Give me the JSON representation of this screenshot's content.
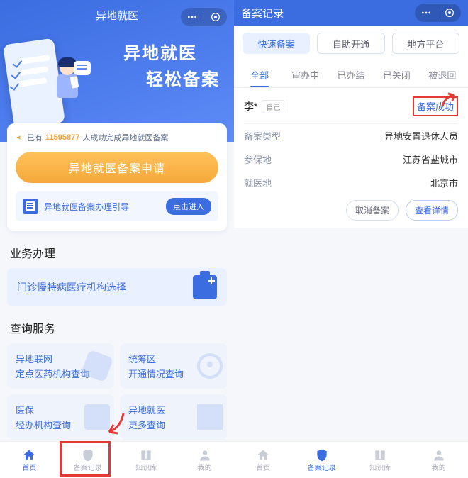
{
  "colors": {
    "primary": "#3b6de0",
    "accent": "#f5a83a",
    "danger": "#e53935"
  },
  "left": {
    "header_title": "异地就医",
    "hero_line1": "异地就医",
    "hero_line2": "轻松备案",
    "count_prefix": "已有",
    "count_number": "11595877",
    "count_suffix": "人成功完成异地就医备案",
    "apply_button": "异地就医备案申请",
    "guide_text": "异地就医备案办理引导",
    "guide_button": "点击进入",
    "section_biz": "业务办理",
    "biz_item": "门诊慢特病医疗机构选择",
    "section_query": "查询服务",
    "query": [
      {
        "l1": "异地联网",
        "l2": "定点医药机构查询"
      },
      {
        "l1": "统筹区",
        "l2": "开通情况查询"
      },
      {
        "l1": "医保",
        "l2": "经办机构查询"
      },
      {
        "l1": "异地就医",
        "l2": "更多查询"
      }
    ],
    "tabs": [
      {
        "label": "首页"
      },
      {
        "label": "备案记录"
      },
      {
        "label": "知识库"
      },
      {
        "label": "我的"
      }
    ]
  },
  "right": {
    "header_title": "备案记录",
    "filters": [
      {
        "label": "快速备案",
        "active": true
      },
      {
        "label": "自助开通",
        "active": false
      },
      {
        "label": "地方平台",
        "active": false
      }
    ],
    "tabs": [
      {
        "label": "全部",
        "active": true
      },
      {
        "label": "审办中"
      },
      {
        "label": "已办结"
      },
      {
        "label": "已关闭"
      },
      {
        "label": "被退回"
      }
    ],
    "record": {
      "name": "李*",
      "who": "自己",
      "status": "备案成功",
      "rows": [
        {
          "k": "备案类型",
          "v": "异地安置退休人员"
        },
        {
          "k": "参保地",
          "v": "江苏省盐城市"
        },
        {
          "k": "就医地",
          "v": "北京市"
        }
      ],
      "actions": {
        "cancel": "取消备案",
        "detail": "查看详情"
      }
    },
    "bottom_tabs": [
      {
        "label": "首页"
      },
      {
        "label": "备案记录"
      },
      {
        "label": "知识库"
      },
      {
        "label": "我的"
      }
    ]
  }
}
